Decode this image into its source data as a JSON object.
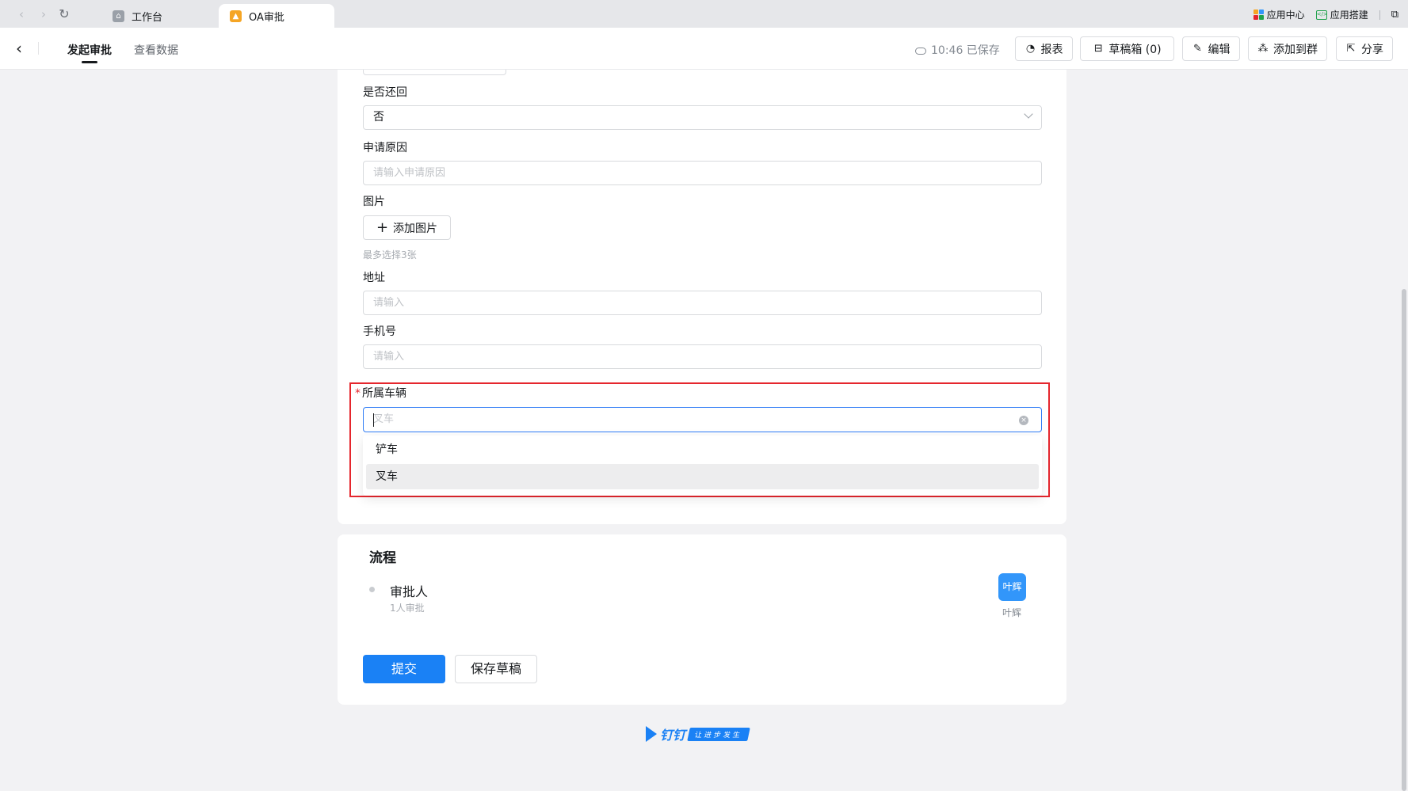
{
  "browser": {
    "tabs": [
      {
        "label": "工作台",
        "active": false
      },
      {
        "label": "OA审批",
        "active": true
      }
    ],
    "right_links": {
      "app_center": "应用中心",
      "app_build": "应用搭建"
    }
  },
  "header": {
    "tabs": [
      "发起审批",
      "查看数据"
    ],
    "saved_status": "10:46 已保存",
    "buttons": {
      "report": "报表",
      "drafts": "草稿箱 (0)",
      "edit": "编辑",
      "add_to_group": "添加到群",
      "share": "分享"
    }
  },
  "form": {
    "return_label": "是否还回",
    "return_value": "否",
    "reason_label": "申请原因",
    "reason_placeholder": "请输入申请原因",
    "image_label": "图片",
    "add_image_button": "添加图片",
    "image_hint": "最多选择3张",
    "address_label": "地址",
    "address_placeholder": "请输入",
    "phone_label": "手机号",
    "phone_placeholder": "请输入",
    "vehicle_required_mark": "*",
    "vehicle_label": "所属车辆",
    "vehicle_placeholder": "叉车",
    "vehicle_options": [
      "铲车",
      "叉车"
    ],
    "vehicle_hovered_option": "叉车"
  },
  "flow": {
    "title": "流程",
    "approver_label": "审批人",
    "approver_sub": "1人审批",
    "approver_avatar_text": "叶辉",
    "approver_name": "叶辉",
    "submit_button": "提交",
    "save_draft_button": "保存草稿"
  },
  "footer": {
    "logo_text": "钉钉",
    "slogan": "让进步发生"
  },
  "colors": {
    "primary": "#1a81f5",
    "highlight_box": "#e5262d",
    "avatar": "#3296fa"
  }
}
